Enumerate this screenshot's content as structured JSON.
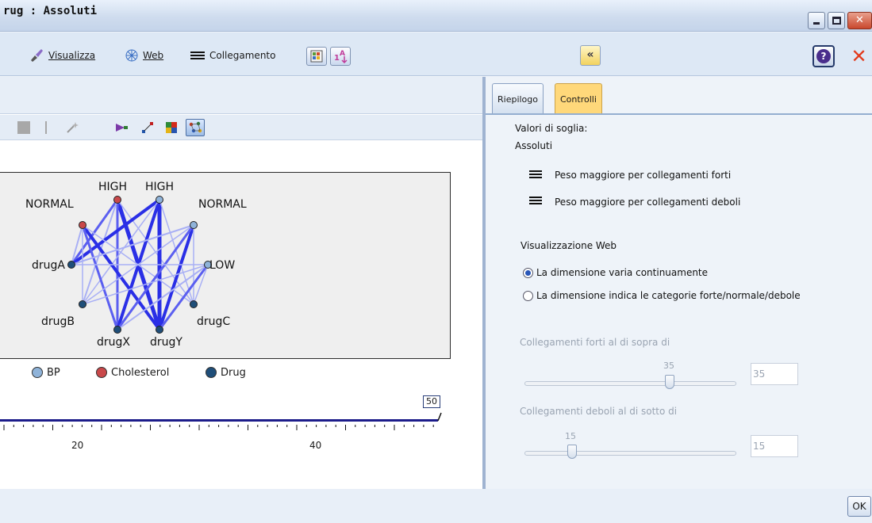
{
  "window": {
    "title": "rug : Assoluti"
  },
  "toolbar": {
    "view_label": "Visualizza",
    "web_label": "Web",
    "link_label": "Collegamento"
  },
  "graph": {
    "nodes": [
      {
        "id": "NORMAL",
        "label": "NORMAL",
        "group": "Cholesterol"
      },
      {
        "id": "HIGH1",
        "label": "HIGH",
        "group": "Cholesterol"
      },
      {
        "id": "HIGH2",
        "label": "HIGH",
        "group": "BP"
      },
      {
        "id": "NORMAL2",
        "label": "NORMAL",
        "group": "BP"
      },
      {
        "id": "LOW",
        "label": "LOW",
        "group": "BP"
      },
      {
        "id": "drugC",
        "label": "drugC",
        "group": "Drug"
      },
      {
        "id": "drugY",
        "label": "drugY",
        "group": "Drug"
      },
      {
        "id": "drugX",
        "label": "drugX",
        "group": "Drug"
      },
      {
        "id": "drugB",
        "label": "drugB",
        "group": "Drug"
      },
      {
        "id": "drugA",
        "label": "drugA",
        "group": "Drug"
      }
    ],
    "legend": [
      {
        "label": "BP",
        "color": "#8fb3d9"
      },
      {
        "label": "Cholesterol",
        "color": "#c9484a"
      },
      {
        "label": "Drug",
        "color": "#1f4e79"
      }
    ],
    "slider": {
      "value": "50",
      "ticks": [
        "20",
        "40"
      ]
    }
  },
  "right": {
    "tabs": [
      "Riepilogo",
      "Controlli"
    ],
    "threshold_label": "Valori di soglia:",
    "threshold_value": "Assoluti",
    "weight_strong": "Peso maggiore per collegamenti forti",
    "weight_weak": "Peso maggiore per collegamenti deboli",
    "web_display_label": "Visualizzazione Web",
    "radio_continuous": "La dimensione varia continuamente",
    "radio_categories": "La dimensione indica le categorie forte/normale/debole",
    "strong_links_label": "Collegamenti forti al di sopra di",
    "strong_value": "35",
    "weak_links_label": "Collegamenti deboli al di sotto di",
    "weak_value": "15"
  },
  "footer": {
    "ok_label": "OK"
  }
}
